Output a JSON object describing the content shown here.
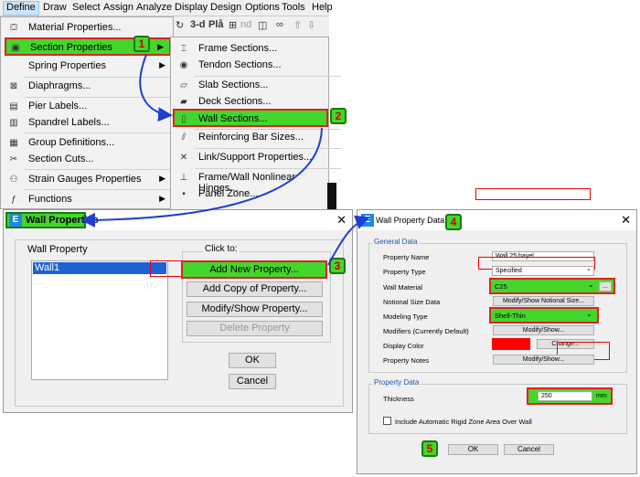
{
  "menubar": [
    "Define",
    "Draw",
    "Select",
    "Assign",
    "Analyze",
    "Display",
    "Design",
    "Options",
    "Tools",
    "Help"
  ],
  "toolbar": {
    "label_3d": "3-d",
    "label_pl": "Plå",
    "label_nd": "nd"
  },
  "define_menu": [
    {
      "label": "Material Properties...",
      "icon": "material-icon"
    },
    {
      "label": "Section Properties",
      "icon": "section-icon",
      "submenu": true,
      "selected": true
    },
    {
      "label": "Spring Properties",
      "icon": "spring-icon",
      "submenu": true
    },
    {
      "label": "Diaphragms...",
      "icon": "diaphragm-icon"
    },
    {
      "label": "Pier Labels...",
      "icon": "pier-icon"
    },
    {
      "label": "Spandrel Labels...",
      "icon": "spandrel-icon"
    },
    {
      "label": "Group Definitions...",
      "icon": "group-icon"
    },
    {
      "label": "Section Cuts...",
      "icon": "section-cut-icon"
    },
    {
      "label": "Strain Gauges Properties",
      "icon": "strain-gauge-icon",
      "submenu": true
    },
    {
      "label": "Functions",
      "icon": "function-icon",
      "submenu": true
    }
  ],
  "section_menu": [
    "Frame Sections...",
    "Tendon Sections...",
    "Slab Sections...",
    "Deck Sections...",
    "Wall Sections...",
    "Reinforcing Bar Sizes...",
    "Link/Support Properties...",
    "Frame/Wall Nonlinear Hinges...",
    "Panel Zone..."
  ],
  "badges": [
    "1",
    "2",
    "3",
    "4",
    "5"
  ],
  "wall_properties": {
    "title": "Wall Properties",
    "list_label": "Wall Property",
    "items": [
      "Wall1"
    ],
    "click_to": "Click to:",
    "buttons": {
      "add_new": "Add New Property...",
      "add_copy": "Add Copy of Property...",
      "modify": "Modify/Show Property...",
      "delete": "Delete Property",
      "ok": "OK",
      "cancel": "Cancel"
    }
  },
  "wall_property_data": {
    "title": "Wall Property Data",
    "general": "General Data",
    "property_name_label": "Property Name",
    "property_name": "Wall 25 hayel",
    "property_type_label": "Property Type",
    "property_type": "Specified",
    "wall_material_label": "Wall Material",
    "wall_material": "C25",
    "notional_label": "Notional Size Data",
    "notional_btn": "Modify/Show Notional Size...",
    "modeling_label": "Modeling Type",
    "modeling": "Shell-Thin",
    "modifiers_label": "Modifiers (Currently Default)",
    "modify_show": "Modify/Show...",
    "display_color_label": "Display Color",
    "change": "Change...",
    "notes_label": "Property Notes",
    "prop_data": "Property Data",
    "thickness_label": "Thickness",
    "thickness": "250",
    "unit": "mm",
    "rigid_zone": "Include Automatic Rigid Zone Area Over Wall",
    "ok": "OK",
    "cancel": "Cancel",
    "ellipsis": "..."
  },
  "colors": {
    "highlight": "#44d62c",
    "badge_border": "#1a7a10",
    "annotation": "#dd2222",
    "arrow": "#1f3fd1",
    "display_color": "#ff0000"
  }
}
